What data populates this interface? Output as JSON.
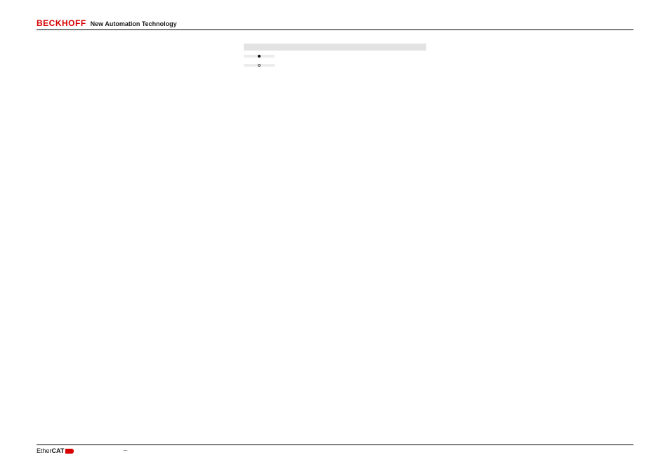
{
  "header": {
    "brand": "BECKHOFF",
    "tagline": "New Automation Technology"
  },
  "table": {
    "rows": [
      {
        "bullet": "none",
        "left": "",
        "right": ""
      },
      {
        "bullet": "filled",
        "left": "",
        "right": ""
      },
      {
        "bullet": "open",
        "left": "",
        "right": ""
      },
      {
        "bullet": "none",
        "left": "",
        "right": ""
      },
      {
        "bullet": "none",
        "left": "",
        "right": ""
      }
    ]
  },
  "footer": {
    "logo_prefix": "Ether",
    "logo_bold": "CAT",
    "note": "—"
  }
}
